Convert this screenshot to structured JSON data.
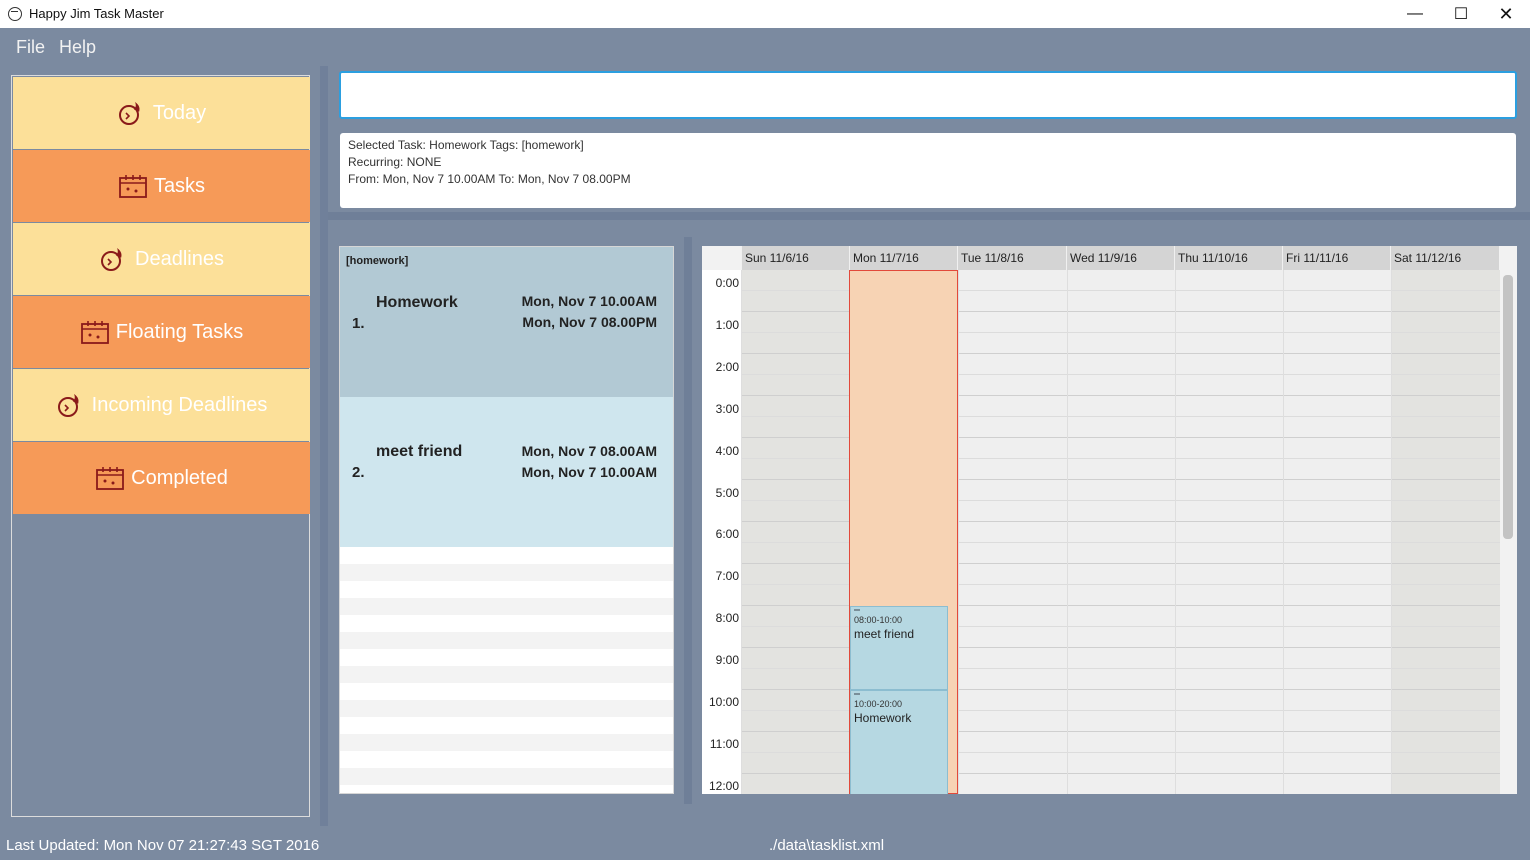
{
  "window": {
    "title": "Happy Jim Task Master",
    "minimize": "—",
    "maximize": "☐",
    "close": "✕"
  },
  "menu": {
    "file": "File",
    "help": "Help"
  },
  "sidebar": {
    "items": [
      {
        "label": "Today",
        "icon": "clock-flame-icon"
      },
      {
        "label": "Tasks",
        "icon": "calendar-icon"
      },
      {
        "label": "Deadlines",
        "icon": "clock-flame-icon"
      },
      {
        "label": "Floating Tasks",
        "icon": "calendar-icon"
      },
      {
        "label": "Incoming Deadlines",
        "icon": "clock-flame-icon"
      },
      {
        "label": "Completed",
        "icon": "calendar-icon"
      }
    ]
  },
  "command": {
    "value": "",
    "placeholder": ""
  },
  "result": {
    "line1": "Selected Task: Homework Tags: [homework]",
    "line2": "Recurring: NONE",
    "line3": "From: Mon, Nov 7 10.00AM To: Mon, Nov 7 08.00PM"
  },
  "tasks": [
    {
      "tags": "[homework]",
      "index": "1.",
      "name": "Homework",
      "start": "Mon, Nov 7 10.00AM",
      "end": "Mon, Nov 7 08.00PM"
    },
    {
      "tags": "",
      "index": "2.",
      "name": "meet friend",
      "start": "Mon, Nov 7 08.00AM",
      "end": "Mon, Nov 7 10.00AM"
    }
  ],
  "calendar": {
    "days": [
      "Sun 11/6/16",
      "Mon 11/7/16",
      "Tue 11/8/16",
      "Wed 11/9/16",
      "Thu 11/10/16",
      "Fri 11/11/16",
      "Sat 11/12/16"
    ],
    "hours": [
      "0:00",
      "1:00",
      "2:00",
      "3:00",
      "4:00",
      "5:00",
      "6:00",
      "7:00",
      "8:00",
      "9:00",
      "10:00",
      "11:00",
      "12:00"
    ],
    "events": [
      {
        "time": "08:00-10:00",
        "name": "meet friend"
      },
      {
        "time": "10:00-20:00",
        "name": "Homework"
      }
    ]
  },
  "status": {
    "last_updated": "Last Updated: Mon Nov 07 21:27:43 SGT 2016",
    "file": "./data\\tasklist.xml"
  },
  "colors": {
    "accent": "#2b9fe0",
    "nav_light": "#fce099",
    "nav_orange": "#f69a58",
    "today": "#f7d3b4",
    "event": "#b6d8e2"
  }
}
